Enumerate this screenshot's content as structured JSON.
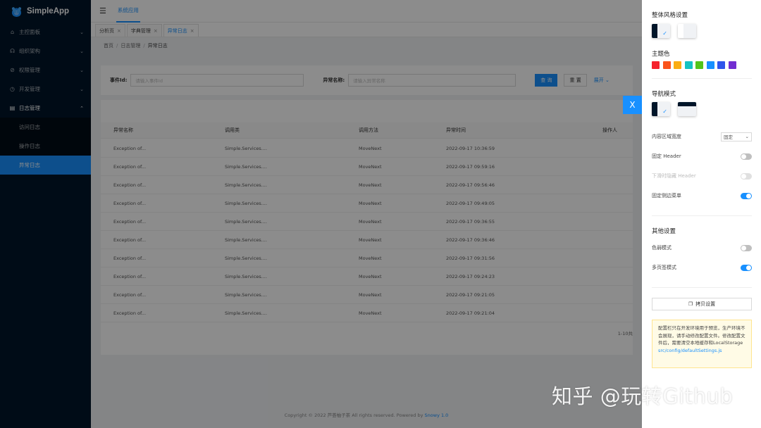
{
  "app": {
    "title": "SimpleApp"
  },
  "sidebar": {
    "items": [
      {
        "icon": "home-icon",
        "label": "主控面板"
      },
      {
        "icon": "org-icon",
        "label": "组织架构"
      },
      {
        "icon": "shield-icon",
        "label": "权限管理"
      },
      {
        "icon": "dev-icon",
        "label": "开发管理"
      },
      {
        "icon": "log-icon",
        "label": "日志管理"
      }
    ],
    "submenu": [
      {
        "label": "访问日志"
      },
      {
        "label": "操作日志"
      },
      {
        "label": "异常日志"
      }
    ]
  },
  "topbar": {
    "tab": "系统应用"
  },
  "tabs": [
    {
      "label": "分析页"
    },
    {
      "label": "字典管理"
    },
    {
      "label": "异常日志"
    }
  ],
  "breadcrumb": [
    "首页",
    "日志管理",
    "异常日志"
  ],
  "search": {
    "event_label": "事件Id:",
    "event_placeholder": "请输入事件Id",
    "name_label": "异常名称:",
    "name_placeholder": "请输入异常名称",
    "query_button": "查 询",
    "reset_button": "重 置",
    "expand_link": "展开"
  },
  "table": {
    "columns": [
      "异常名称",
      "调用类",
      "调用方法",
      "异常时间",
      "操作人"
    ],
    "rows": [
      [
        "Exception of...",
        "Simple.Services....",
        "MoveNext",
        "2022-09-17 10:36:59"
      ],
      [
        "Exception of...",
        "Simple.Services....",
        "MoveNext",
        "2022-09-17 09:59:16"
      ],
      [
        "Exception of...",
        "Simple.Services....",
        "MoveNext",
        "2022-09-17 09:56:46"
      ],
      [
        "Exception of...",
        "Simple.Services....",
        "MoveNext",
        "2022-09-17 09:49:05"
      ],
      [
        "Exception of...",
        "Simple.Services....",
        "MoveNext",
        "2022-09-17 09:36:55"
      ],
      [
        "Exception of...",
        "Simple.Services....",
        "MoveNext",
        "2022-09-17 09:36:46"
      ],
      [
        "Exception of...",
        "Simple.Services....",
        "MoveNext",
        "2022-09-17 09:31:56"
      ],
      [
        "Exception of...",
        "Simple.Services....",
        "MoveNext",
        "2022-09-17 09:24:23"
      ],
      [
        "Exception of...",
        "Simple.Services....",
        "MoveNext",
        "2022-09-17 09:21:05"
      ],
      [
        "Exception of...",
        "Simple.Services....",
        "MoveNext",
        "2022-09-17 09:21:04"
      ]
    ],
    "pagination_text": "1-10共"
  },
  "footer": {
    "text": "Copyright © 2022 芦荟柚子茶 All rights reserved. Powered by ",
    "brand": "Snowy 1.0"
  },
  "drawer": {
    "close": "X",
    "style_title": "整体风格设置",
    "theme_title": "主题色",
    "theme_colors": [
      "#f5222d",
      "#fa541c",
      "#faad14",
      "#13c2c2",
      "#52c41a",
      "#1890ff",
      "#2f54eb",
      "#722ed1"
    ],
    "nav_title": "导航模式",
    "settings": [
      {
        "label": "内容区域宽度",
        "value": "固定"
      },
      {
        "label": "固定 Header",
        "on": false
      },
      {
        "label": "下滑时隐藏 Header",
        "on": false,
        "disabled": true
      },
      {
        "label": "固定侧边菜单",
        "on": true
      }
    ],
    "other_title": "其他设置",
    "other": [
      {
        "label": "色弱模式",
        "on": false
      },
      {
        "label": "多页签模式",
        "on": true
      }
    ],
    "copy_button": "拷贝设置",
    "notice_text": "配置栏只在开发环境用于预览，生产环境不会展现，请手动修改配置文件。修改配置文件后，需要清空本地缓存和LocalStorage",
    "notice_path": "src/config/defaultSettings.js"
  },
  "watermark": "知乎 @玩转Github"
}
